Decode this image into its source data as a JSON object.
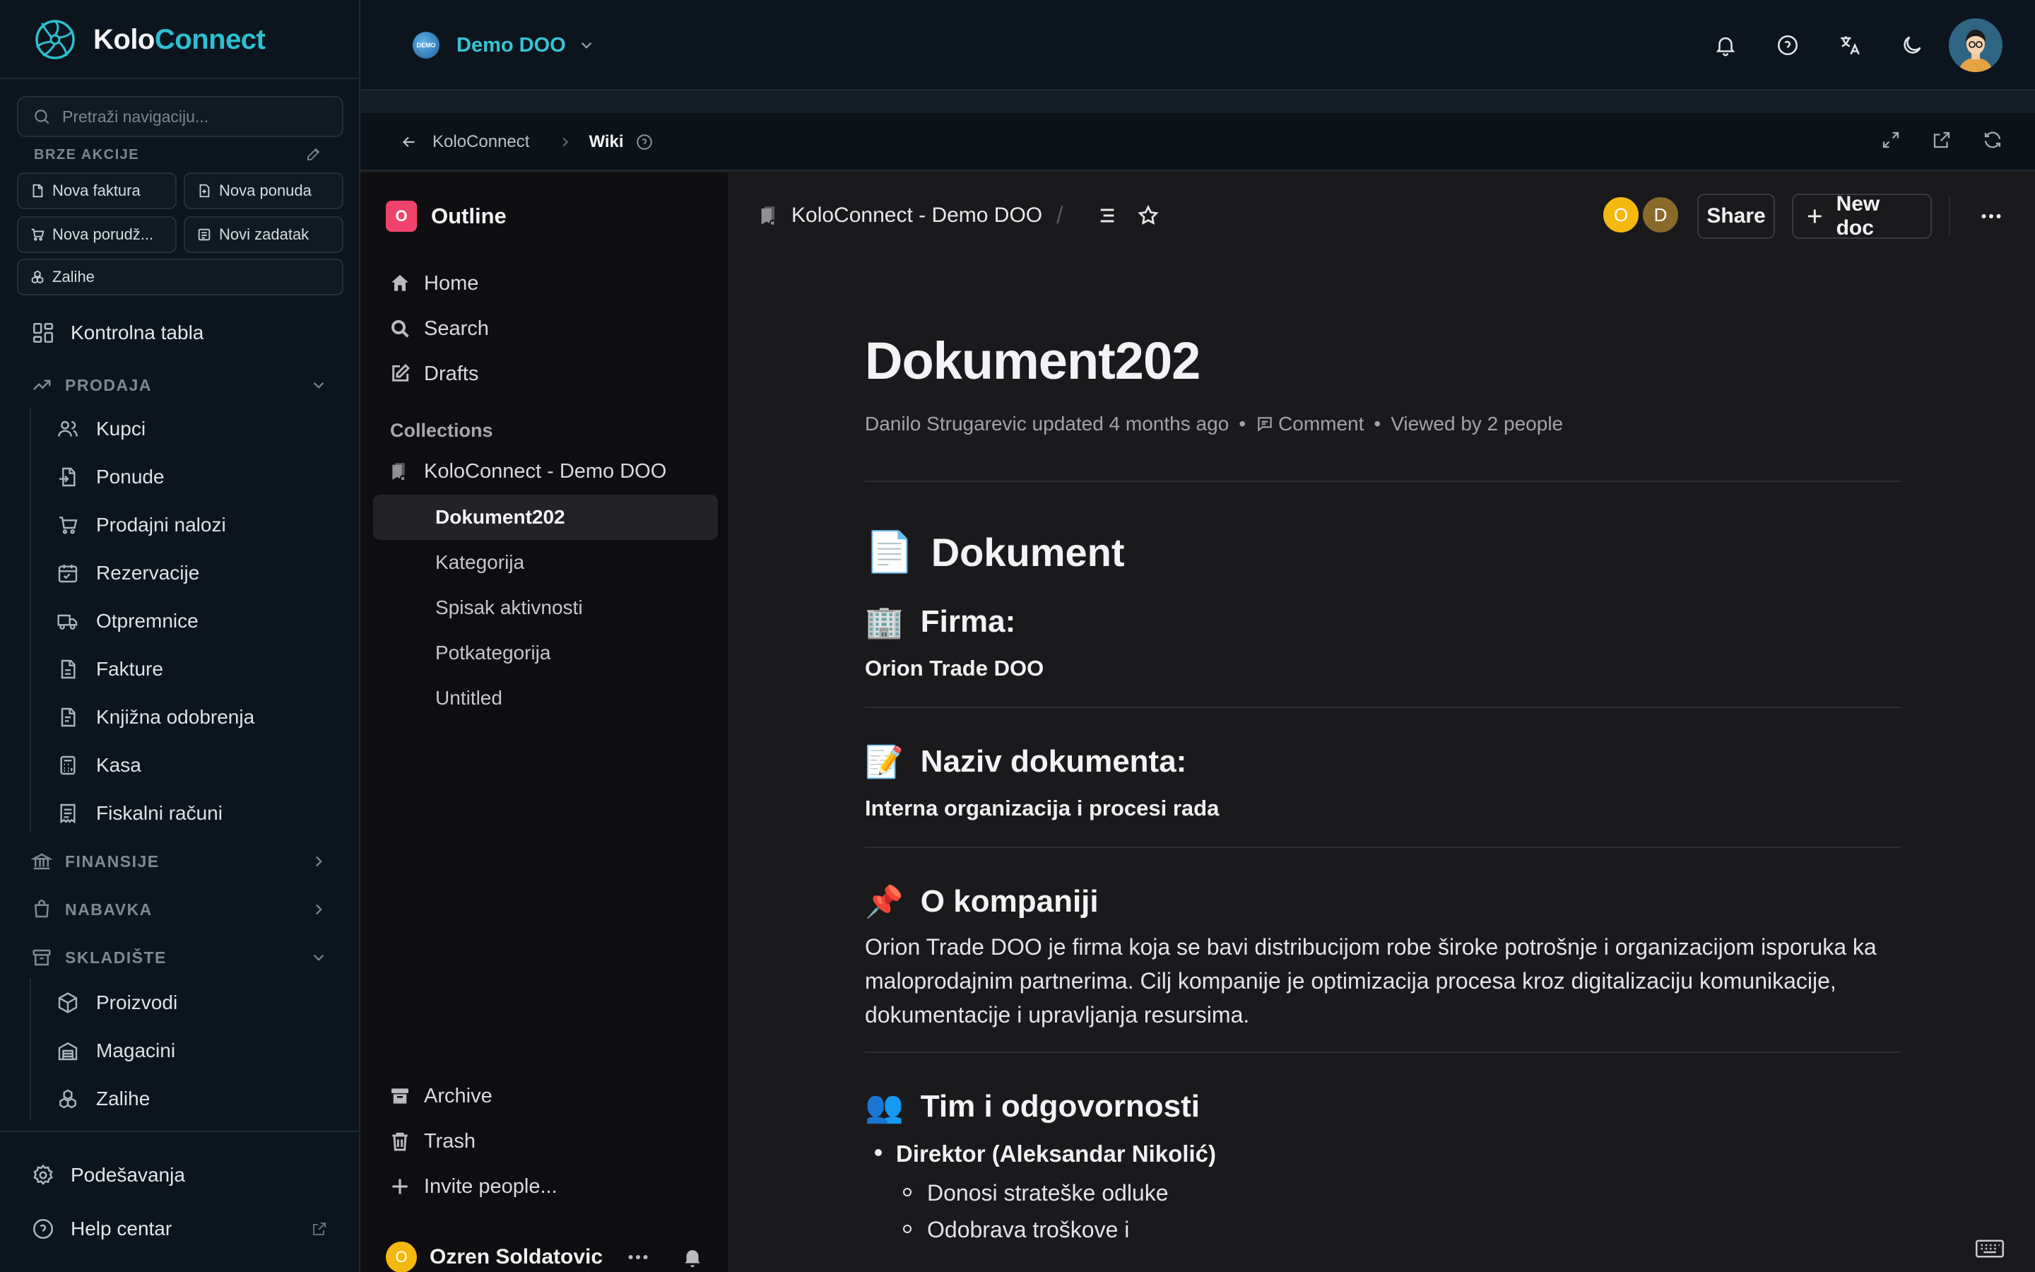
{
  "app": {
    "name_part1": "Kolo",
    "name_part2": "Connect",
    "brand_color": "#2dbfd0"
  },
  "sidebar": {
    "search_placeholder": "Pretraži navigaciju...",
    "quick_actions_title": "BRZE AKCIJE",
    "quick_actions": [
      {
        "label": "Nova faktura",
        "icon": "invoice-icon"
      },
      {
        "label": "Nova ponuda",
        "icon": "offer-icon"
      },
      {
        "label": "Nova porudž...",
        "icon": "order-icon"
      },
      {
        "label": "Novi zadatak",
        "icon": "task-icon"
      },
      {
        "label": "Zalihe",
        "icon": "stock-icon"
      }
    ],
    "dashboard": "Kontrolna tabla",
    "sections": {
      "prodaja": "PRODAJA",
      "finansije": "FINANSIJE",
      "nabavka": "NABAVKA",
      "skladiste": "SKLADIŠTE"
    },
    "prodaja_items": [
      "Kupci",
      "Ponude",
      "Prodajni nalozi",
      "Rezervacije",
      "Otpremnice",
      "Fakture",
      "Knjižna odobrenja",
      "Kasa",
      "Fiskalni računi"
    ],
    "skladiste_items": [
      "Proizvodi",
      "Magacini",
      "Zalihe"
    ],
    "settings": "Podešavanja",
    "help": "Help centar"
  },
  "topbar": {
    "company": "Demo DOO",
    "company_badge": "DEMO"
  },
  "subheader": {
    "back_label": "KoloConnect",
    "current": "Wiki"
  },
  "outline": {
    "logo_letter": "O",
    "title": "Outline",
    "nav": [
      "Home",
      "Search",
      "Drafts"
    ],
    "collections_title": "Collections",
    "collection_name": "KoloConnect - Demo DOO",
    "docs": [
      "Dokument202",
      "Kategorija",
      "Spisak aktivnosti",
      "Potkategorija",
      "Untitled"
    ],
    "bottom": [
      "Archive",
      "Trash",
      "Invite people..."
    ],
    "user_initial": "O",
    "user_name": "Ozren Soldatovic"
  },
  "doc": {
    "breadcrumb": "KoloConnect - Demo DOO",
    "collaborators": [
      {
        "initial": "O",
        "color": "#f5b80f"
      },
      {
        "initial": "D",
        "color": "#8a6a2a"
      }
    ],
    "share_label": "Share",
    "new_doc_label": "New doc",
    "title": "Dokument202",
    "meta_author": "Danilo Strugarevic updated 4 months ago",
    "meta_comment": "Comment",
    "meta_viewed": "Viewed by 2 people",
    "h1_emoji": "📄",
    "h1": "Dokument",
    "firma_emoji": "🏢",
    "firma_label": "Firma:",
    "firma_value": "Orion Trade DOO",
    "naziv_emoji": "📝",
    "naziv_label": "Naziv dokumenta:",
    "naziv_value": "Interna organizacija i procesi rada",
    "o_emoji": "📌",
    "o_label": "O kompaniji",
    "o_text": "Orion Trade DOO je firma koja se bavi distribucijom robe široke potrošnje i organizacijom isporuka ka maloprodajnim partnerima. Cilj kompanije je optimizacija procesa kroz digitalizaciju komunikacije, dokumentacije i upravljanja resursima.",
    "tim_emoji": "👥",
    "tim_label": "Tim i odgovornosti",
    "tim_items": [
      {
        "role": "Direktor (Aleksandar Nikolić)",
        "sub": [
          "Donosi strateške odluke",
          "Odobrava troškove i"
        ]
      }
    ]
  }
}
